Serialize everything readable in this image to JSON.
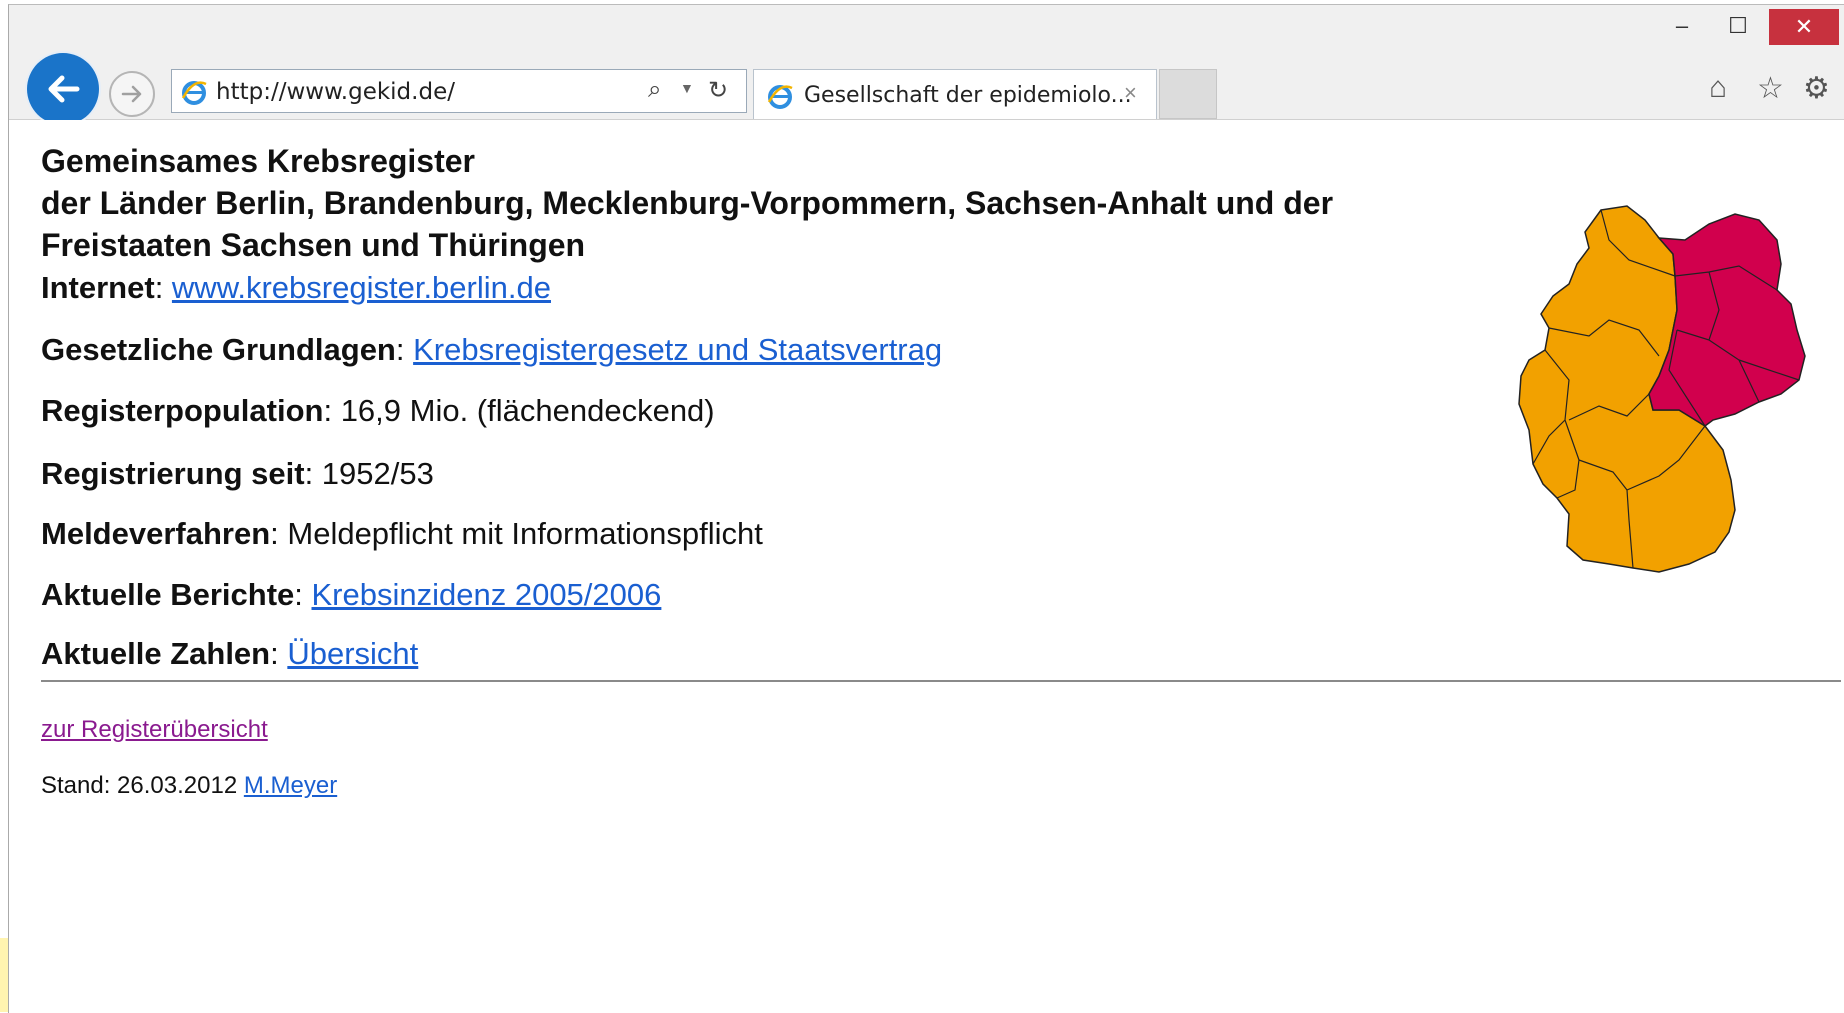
{
  "browser": {
    "address": "http://www.gekid.de/",
    "tab_title": "Gesellschaft der epidemiolo...",
    "tab_close": "×",
    "window_minimize": "–",
    "window_maximize": "☐",
    "window_close": "✕"
  },
  "page": {
    "heading_lines": [
      "Gemeinsames Krebsregister",
      "der Länder Berlin, Brandenburg, Mecklenburg-Vorpommern, Sachsen-Anhalt und der",
      "Freistaaten Sachsen und Thüringen"
    ],
    "rows": [
      {
        "label": "Internet",
        "sep": ": ",
        "link": "www.krebsregister.berlin.de"
      },
      {
        "label": "Gesetzliche Grundlagen",
        "sep": ": ",
        "link": "Krebsregistergesetz und Staatsvertrag"
      },
      {
        "label": "Registerpopulation",
        "sep": ": ",
        "text": "16,9 Mio. (flächendeckend)"
      },
      {
        "label": "Registrierung seit",
        "sep": ": ",
        "text": "1952/53"
      },
      {
        "label": "Meldeverfahren",
        "sep": ": ",
        "text": "Meldepflicht mit Informationspflicht"
      },
      {
        "label": "Aktuelle Berichte",
        "sep": ": ",
        "link": "Krebsinzidenz 2005/2006"
      },
      {
        "label": "Aktuelle Zahlen",
        "sep": ": ",
        "link": "Übersicht"
      }
    ],
    "back_link": "zur Registerübersicht",
    "stand_text": "Stand: 26.03.2012 ",
    "stand_link": "M.Meyer"
  },
  "map_colors": {
    "register_states": "#d1004d",
    "other_states": "#f2a100"
  },
  "icons": [
    "back-arrow-icon",
    "forward-arrow-icon",
    "ie-logo-icon",
    "search-icon",
    "refresh-icon",
    "home-icon",
    "star-icon",
    "gear-icon"
  ]
}
